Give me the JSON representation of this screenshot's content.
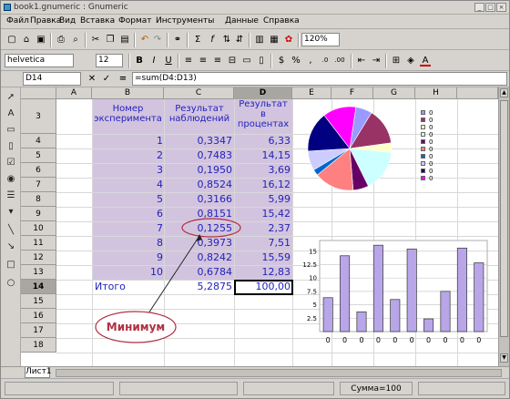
{
  "window": {
    "title": "book1.gnumeric : Gnumeric"
  },
  "menu": [
    "Файл",
    "Правка",
    "Вид",
    "Вставка",
    "Формат",
    "Инструменты",
    "Данные",
    "Справка"
  ],
  "toolbar": {
    "zoom": "120%",
    "font_name": "helvetica",
    "font_size": "12"
  },
  "formula": {
    "cell_ref": "D14",
    "text": "=sum(D4:D13)"
  },
  "columns": [
    "A",
    "B",
    "C",
    "D",
    "E",
    "F",
    "G",
    "H"
  ],
  "rows": [
    "3",
    "4",
    "5",
    "6",
    "7",
    "8",
    "9",
    "10",
    "11",
    "12",
    "13",
    "14",
    "15",
    "16",
    "17",
    "18"
  ],
  "headers": {
    "b": "Номер эксперимента",
    "c": "Результат наблюдений",
    "d": "Результат в процентах"
  },
  "data": [
    {
      "n": "1",
      "c": "0,3347",
      "d": "6,33"
    },
    {
      "n": "2",
      "c": "0,7483",
      "d": "14,15"
    },
    {
      "n": "3",
      "c": "0,1950",
      "d": "3,69"
    },
    {
      "n": "4",
      "c": "0,8524",
      "d": "16,12"
    },
    {
      "n": "5",
      "c": "0,3166",
      "d": "5,99"
    },
    {
      "n": "6",
      "c": "0,8151",
      "d": "15,42"
    },
    {
      "n": "7",
      "c": "0,1255",
      "d": "2,37"
    },
    {
      "n": "8",
      "c": "0,3973",
      "d": "7,51"
    },
    {
      "n": "9",
      "c": "0,8242",
      "d": "15,59"
    },
    {
      "n": "10",
      "c": "0,6784",
      "d": "12,83"
    }
  ],
  "total": {
    "label": "Итого",
    "c": "5,2875",
    "d": "100,00"
  },
  "annotation": "Минимум",
  "sheet_tab": "Лист1",
  "status": {
    "sum": "Сумма=100"
  },
  "pie_legend": [
    "0",
    "0",
    "0",
    "0",
    "0",
    "0",
    "0",
    "0",
    "0",
    "0"
  ],
  "pie_colors": [
    "#9999ff",
    "#993366",
    "#ffffcc",
    "#ccffff",
    "#660066",
    "#ff8080",
    "#0066cc",
    "#ccccff",
    "#000080",
    "#ff00ff"
  ],
  "bar_chart": {
    "y_ticks": [
      "15",
      "12.5",
      "10",
      "7.5",
      "5",
      "2.5"
    ],
    "x_labels": [
      "0",
      "0",
      "0",
      "0",
      "0",
      "0",
      "0",
      "0",
      "0",
      "0"
    ],
    "bar_color": "#b8a6e8"
  }
}
